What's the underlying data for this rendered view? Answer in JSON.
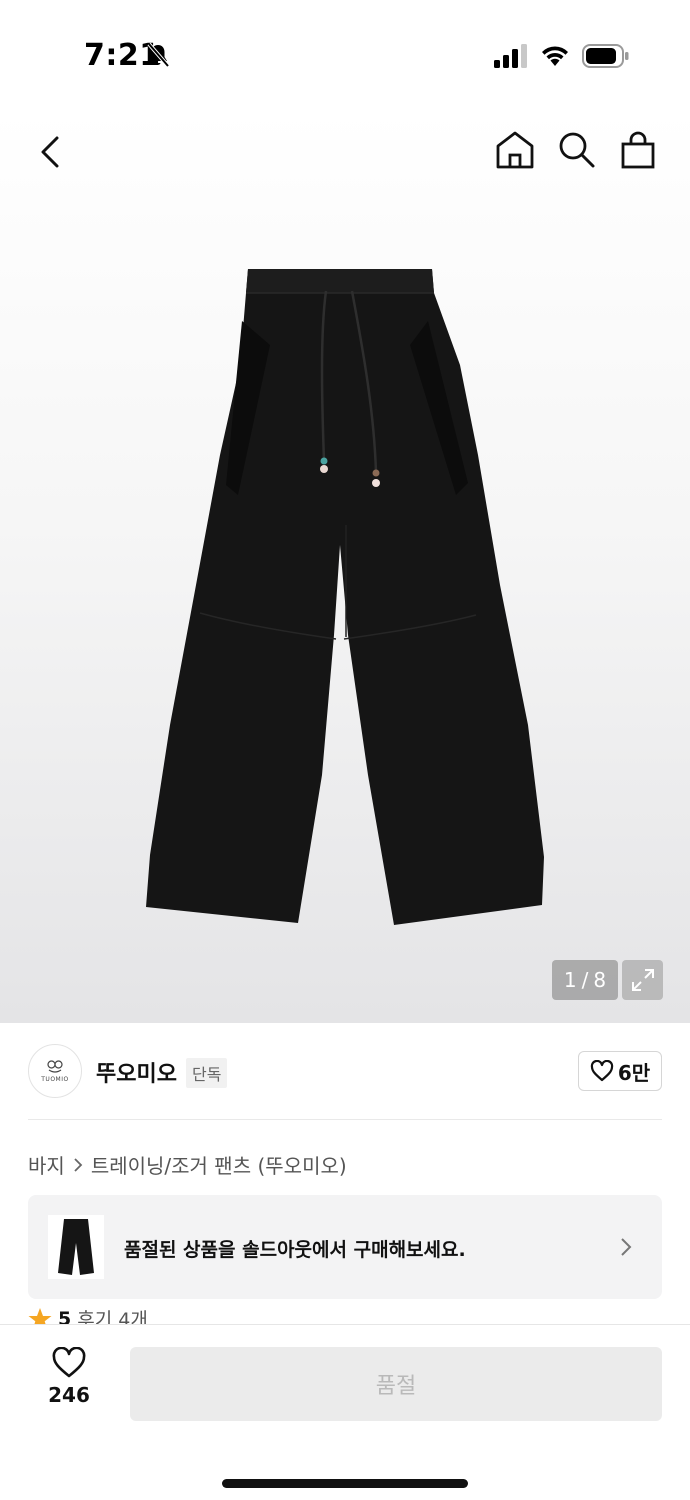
{
  "status_bar": {
    "time": "7:21",
    "icons": [
      "bell-off-icon",
      "cellular-signal-icon",
      "wifi-icon",
      "battery-icon"
    ]
  },
  "top_nav": {
    "icons": [
      "back-arrow-icon",
      "home-icon",
      "search-icon",
      "shopping-bag-icon"
    ]
  },
  "gallery": {
    "current": "1",
    "separator": "/",
    "total": "8",
    "expand_icon": "expand-icon"
  },
  "brand": {
    "logo_text": "TUOMIO",
    "name": "뚜오미오",
    "badge": "단독",
    "like_count": "6만"
  },
  "breadcrumb": {
    "category": "바지",
    "subcategory": "트레이닝/조거 팬츠 (뚜오미오)"
  },
  "soldout_banner": {
    "text": "품절된 상품을 솔드아웃에서 구매해보세요."
  },
  "rating": {
    "value": "5",
    "reviews": "후기 4개"
  },
  "bottom_bar": {
    "wish_count": "246",
    "buy_label": "품절"
  },
  "colors": {
    "star": "#f5a623",
    "product_black": "#141414",
    "disabled_button": "#ebebeb"
  }
}
